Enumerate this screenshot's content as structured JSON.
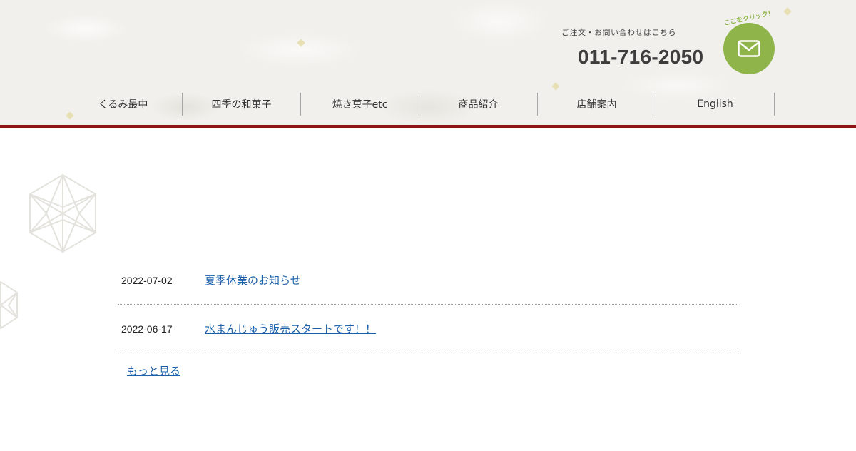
{
  "header": {
    "contact_text": "ご注文・お問い合わせはこちら",
    "phone": "011-716-2050",
    "click_label": "ここをクリック！",
    "mail_icon": "envelope-icon",
    "colors": {
      "accent": "#8fb54a",
      "bar": "#8c1414",
      "link": "#1a5fa8"
    }
  },
  "nav": {
    "items": [
      {
        "label": "くるみ最中"
      },
      {
        "label": "四季の和菓子"
      },
      {
        "label": "焼き菓子etc"
      },
      {
        "label": "商品紹介"
      },
      {
        "label": "店舗案内"
      },
      {
        "label": "English"
      }
    ]
  },
  "news": {
    "items": [
      {
        "date": "2022-07-02",
        "title": "夏季休業のお知らせ"
      },
      {
        "date": "2022-06-17",
        "title": "水まんじゅう販売スタートです！！"
      }
    ],
    "more_label": "もっと見る"
  }
}
